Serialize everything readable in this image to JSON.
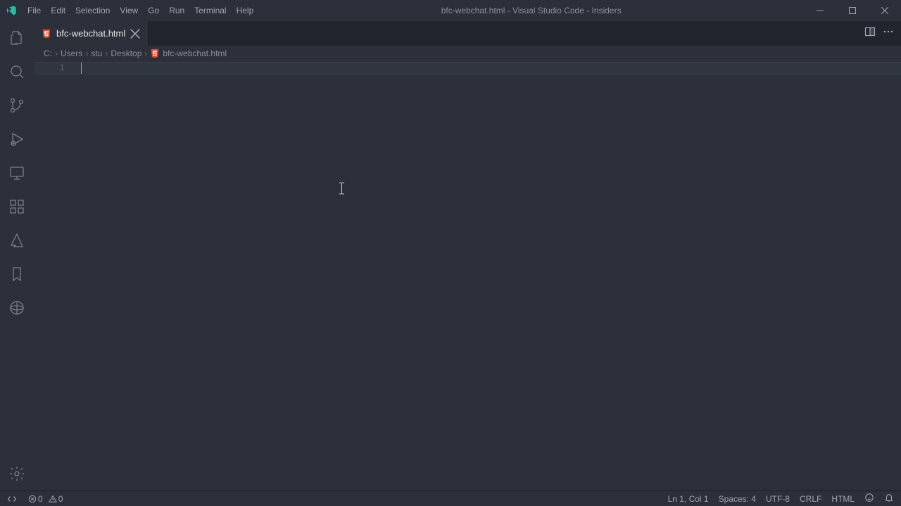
{
  "window": {
    "title": "bfc-webchat.html - Visual Studio Code - Insiders"
  },
  "menu": {
    "items": [
      "File",
      "Edit",
      "Selection",
      "View",
      "Go",
      "Run",
      "Terminal",
      "Help"
    ]
  },
  "tab": {
    "label": "bfc-webchat.html"
  },
  "breadcrumb": {
    "parts": [
      "C:",
      "Users",
      "stu",
      "Desktop"
    ],
    "file": "bfc-webchat.html"
  },
  "editor": {
    "line_number": "1"
  },
  "statusbar": {
    "errors": "0",
    "warnings": "0",
    "cursor": "Ln 1, Col 1",
    "spaces": "Spaces: 4",
    "encoding": "UTF-8",
    "eol": "CRLF",
    "language": "HTML"
  },
  "colors": {
    "html_orange": "#e44d26"
  }
}
